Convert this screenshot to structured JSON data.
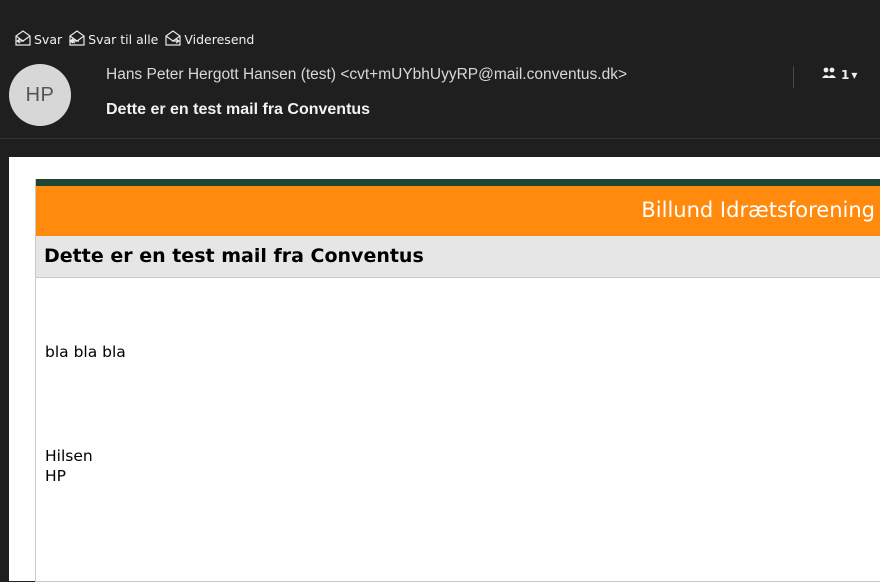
{
  "actions": {
    "reply": "Svar",
    "reply_all": "Svar til alle",
    "forward": "Videresend"
  },
  "sender": {
    "initials": "HP",
    "from": "Hans Peter Hergott Hansen (test) <cvt+mUYbhUyyRP@mail.conventus.dk>",
    "recipients_count": "1"
  },
  "subject": "Dette er en test mail fra Conventus",
  "email": {
    "banner": "Billund Idrætsforening",
    "heading": "Dette er en test mail fra Conventus",
    "body": "bla bla bla",
    "greeting": "Hilsen",
    "signature": "HP"
  },
  "colors": {
    "dark_bg": "#1f1f1f",
    "banner_orange": "#ff8a0d",
    "stripe_green": "#1f4533",
    "heading_bg": "#e6e6e6"
  }
}
